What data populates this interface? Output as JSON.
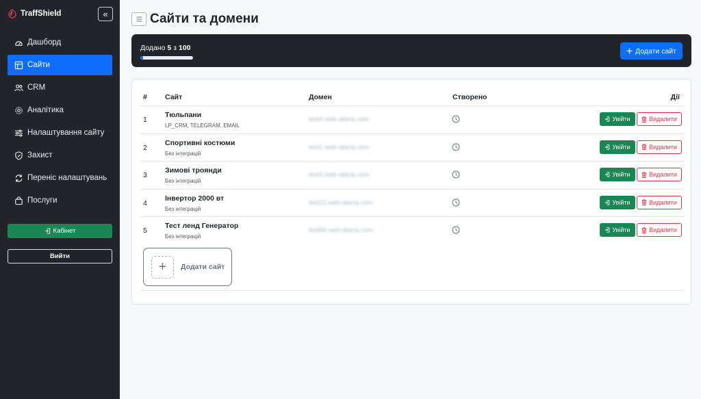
{
  "app": {
    "brand": "TraffShield"
  },
  "sidebar": {
    "collapse_glyph": "«",
    "items": [
      {
        "label": "Дашборд",
        "icon": "dashboard-icon",
        "active": false
      },
      {
        "label": "Сайти",
        "icon": "layout-icon",
        "active": true
      },
      {
        "label": "CRM",
        "icon": "users-icon",
        "active": false
      },
      {
        "label": "Аналітика",
        "icon": "gear-icon",
        "active": false
      },
      {
        "label": "Налаштування сайту",
        "icon": "sliders-icon",
        "active": false
      },
      {
        "label": "Захист",
        "icon": "shield-icon",
        "active": false
      },
      {
        "label": "Переніс налаштувань",
        "icon": "sync-icon",
        "active": false
      },
      {
        "label": "Послуги",
        "icon": "bag-icon",
        "active": false
      }
    ],
    "cabinet_label": "Кабінет",
    "logout_label": "Вийти"
  },
  "header": {
    "title": "Сайти та домени"
  },
  "summary": {
    "prefix": "Додано",
    "count": "5",
    "sep": "з",
    "total": "100",
    "progress_fraction": 0.05,
    "add_button_label": "Додати сайт"
  },
  "table": {
    "headers": {
      "num": "#",
      "site": "Сайт",
      "domain": "Домен",
      "created": "Створено",
      "actions": "Дії"
    },
    "login_label": "Увійти",
    "delete_label": "Видалити",
    "rows": [
      {
        "num": "1",
        "name": "Тюльпани",
        "integrations": "LP_CRM, TELEGRAM, EMAIL",
        "domain": "test4.web-ataria.com"
      },
      {
        "num": "2",
        "name": "Спортивні костюми",
        "integrations": "Без інтеграцій",
        "domain": "test1.web-ataria.com"
      },
      {
        "num": "3",
        "name": "Зимові троянди",
        "integrations": "Без інтеграцій",
        "domain": "test3.web-ataria.com"
      },
      {
        "num": "4",
        "name": "Інвертор 2000 вт",
        "integrations": "Без інтеграцій",
        "domain": "test22.web-ataria.com"
      },
      {
        "num": "5",
        "name": "Тест ленд Генератор",
        "integrations": "Без інтеграцій",
        "domain": "test66.web-ataria.com"
      }
    ],
    "add_tile_label": "Додати сайт"
  },
  "colors": {
    "sidebar_bg": "#212529",
    "accent": "#0d6efd",
    "success": "#198754",
    "danger": "#dc3545"
  }
}
